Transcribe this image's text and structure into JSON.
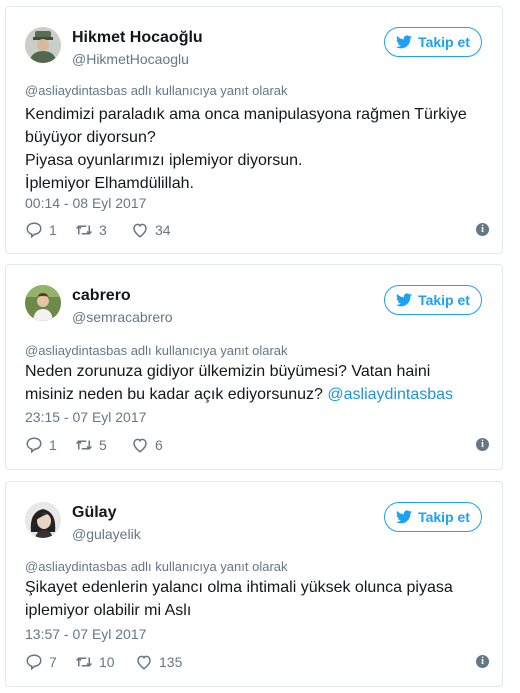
{
  "tweets": [
    {
      "name": "Hikmet Hocaoğlu",
      "handle": "@HikmetHocaoglu",
      "follow_label": "Takip et",
      "reply_to": "@asliaydintasbas adlı kullanıcıya yanıt olarak",
      "lines": [
        "Kendimizi paraladık ama onca manipulasyona rağmen Türkiye",
        "büyüyor diyorsun?",
        "Piyasa oyunlarımızı iplemiyor diyorsun.",
        "İplemiyor Elhamdülillah."
      ],
      "timestamp": "00:14 - 08 Eyl 2017",
      "replies": "1",
      "retweets": "3",
      "likes": "34"
    },
    {
      "name": "cabrero",
      "handle": "@semracabrero",
      "follow_label": "Takip et",
      "reply_to": "@asliaydintasbas adlı kullanıcıya yanıt olarak",
      "lines": [
        "Neden zorunuza gidiyor ülkemizin büyümesi? Vatan haini",
        "misiniz neden bu kadar açık ediyorsunuz?"
      ],
      "mention": "@asliaydintasbas",
      "timestamp": "23:15 - 07 Eyl 2017",
      "replies": "1",
      "retweets": "5",
      "likes": "6"
    },
    {
      "name": "Gülay",
      "handle": "@gulayelik",
      "follow_label": "Takip et",
      "reply_to": "@asliaydintasbas adlı kullanıcıya yanıt olarak",
      "lines": [
        "Şikayet edenlerin yalancı olma ihtimali yüksek olunca piyasa",
        "iplemiyor olabilir mi Aslı"
      ],
      "timestamp": "13:57 - 07 Eyl 2017",
      "replies": "7",
      "retweets": "10",
      "likes": "135"
    }
  ],
  "icons": {
    "follow": "twitter-bird-icon",
    "reply": "reply-icon",
    "retweet": "retweet-icon",
    "like": "heart-icon",
    "info": "info-icon"
  },
  "colors": {
    "accent": "#1da1f2",
    "mention": "#1b95e0",
    "muted": "#657786",
    "border": "#e1e8ed"
  }
}
